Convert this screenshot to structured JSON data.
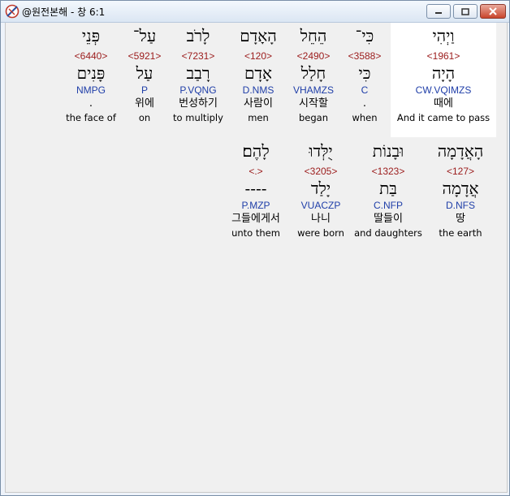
{
  "window": {
    "title": "@원전본해 - 창 6:1"
  },
  "words": [
    {
      "heb": "וַיְהִי",
      "strong": "<1961>",
      "lex": "הָיָה",
      "morph": "CW.VQIMZS",
      "kor": "때에",
      "eng": "And it came to pass",
      "selected": true
    },
    {
      "heb": "כִּי־",
      "strong": "<3588>",
      "lex": "כִּי",
      "morph": "C",
      "kor": ".",
      "eng": "when"
    },
    {
      "heb": "הֵחֵל",
      "strong": "<2490>",
      "lex": "חָלַל",
      "morph": "VHAMZS",
      "kor": "시작할",
      "eng": "began"
    },
    {
      "heb": "הָאָדָם",
      "strong": "<120>",
      "lex": "אָדָם",
      "morph": "D.NMS",
      "kor": "사람이",
      "eng": "men"
    },
    {
      "heb": "לָרֹב",
      "strong": "<7231>",
      "lex": "רָבַב",
      "morph": "P.VQNG",
      "kor": "번성하기",
      "eng": "to multiply"
    },
    {
      "heb": "עַל־",
      "strong": "<5921>",
      "lex": "עַל",
      "morph": "P",
      "kor": "위에",
      "eng": "on"
    },
    {
      "heb": "פְּנֵי",
      "strong": "<6440>",
      "lex": "פָּנִים",
      "morph": "NMPG",
      "kor": ".",
      "eng": "the face of"
    },
    {
      "heb": "הָאֲדָמָה",
      "strong": "<127>",
      "lex": "אֲדָמָה",
      "morph": "D.NFS",
      "kor": "땅",
      "eng": "the earth"
    },
    {
      "heb": "וּבָנוֹת",
      "strong": "<1323>",
      "lex": "בַּת",
      "morph": "C.NFP",
      "kor": "딸들이",
      "eng": "and daughters"
    },
    {
      "heb": "יֻלְּדוּ",
      "strong": "<3205>",
      "lex": "יָלַד",
      "morph": "VUACZP",
      "kor": "나니",
      "eng": "were born"
    },
    {
      "heb": "לָהֶם׃",
      "strong": "<.>",
      "lex": "----",
      "morph": "P.MZP",
      "kor": "그들에게서",
      "eng": "unto them"
    }
  ]
}
